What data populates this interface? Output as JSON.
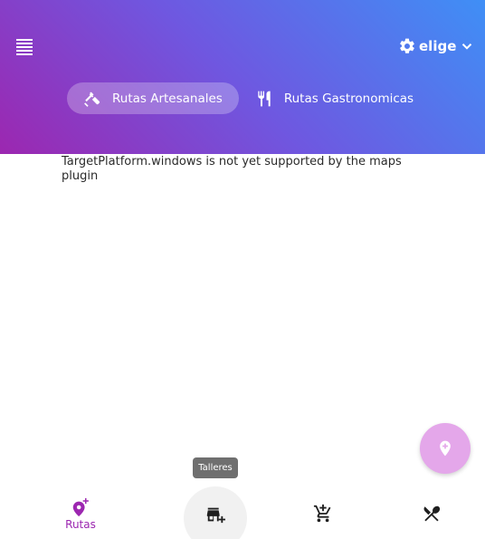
{
  "header": {
    "gradient": [
      "#9c27b0",
      "#6f57e0",
      "#3f8ff6"
    ],
    "menu_icon": "menu-icon",
    "selector": {
      "icon": "gear-icon",
      "label": "elige",
      "chevron": "chevron-down-icon"
    },
    "tabs": [
      {
        "label": "Rutas Artesanales",
        "icon": "tools-icon",
        "active": true
      },
      {
        "label": "Rutas Gastronomicas",
        "icon": "restaurant-icon",
        "active": false
      }
    ]
  },
  "map": {
    "message": "TargetPlatform.windows is not yet supported by the maps plugin"
  },
  "fab": {
    "icon": "location-pin-icon",
    "color": "#e4a7ea"
  },
  "tooltip": {
    "text": "Talleres"
  },
  "bottom_nav": {
    "accent": "#9c27b0",
    "items": [
      {
        "label": "Rutas",
        "icon": "add-location-icon",
        "selected": true
      },
      {
        "label": "",
        "icon": "add-business-icon",
        "selected": false
      },
      {
        "label": "",
        "icon": "add-shopping-cart-icon",
        "selected": false
      },
      {
        "label": "",
        "icon": "no-meals-icon",
        "selected": false
      }
    ]
  }
}
